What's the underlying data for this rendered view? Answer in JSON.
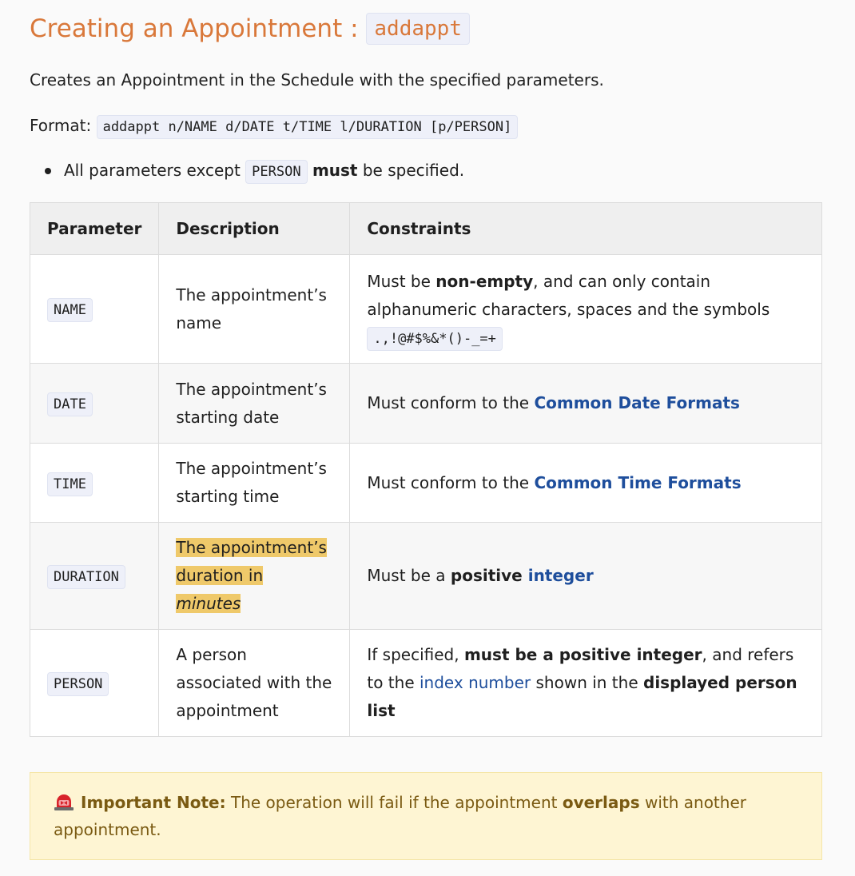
{
  "heading": {
    "title": "Creating an Appointment : ",
    "command": "addappt"
  },
  "description": "Creates an Appointment in the Schedule with the specified parameters.",
  "format": {
    "label": "Format: ",
    "command": "addappt n/NAME d/DATE t/TIME l/DURATION [p/PERSON]"
  },
  "bullet": {
    "pre": "All parameters except ",
    "code": "PERSON",
    "bold": "must",
    "post": " be specified."
  },
  "table": {
    "headers": [
      "Parameter",
      "Description",
      "Constraints"
    ],
    "rows": [
      {
        "param": "NAME",
        "desc": "The appointment’s name",
        "c_pre": "Must be ",
        "c_bold": "non-empty",
        "c_mid": ", and can only contain alphanumeric characters, spaces and the symbols ",
        "c_code": ".,!@#$%&*()-_=+"
      },
      {
        "param": "DATE",
        "desc": "The appointment’s starting date",
        "c_pre": "Must conform to the ",
        "c_link": "Common Date Formats"
      },
      {
        "param": "TIME",
        "desc": "The appointment’s starting time",
        "c_pre": "Must conform to the ",
        "c_link": "Common Time Formats"
      },
      {
        "param": "DURATION",
        "desc_pre": "The appointment’s duration in ",
        "desc_em": "minutes",
        "c_pre": "Must be a ",
        "c_bold": "positive",
        "c_link": " integer"
      },
      {
        "param": "PERSON",
        "desc": "A person associated with the appointment",
        "c_pre": "If specified, ",
        "c_bold": "must be a positive integer",
        "c_mid": ", and refers to the ",
        "c_link": "index number",
        "c_mid2": " shown in the ",
        "c_bold2": "displayed person list"
      }
    ]
  },
  "note": {
    "icon": "siren-icon",
    "label": "Important Note:",
    "pre": " The operation will fail if the appointment ",
    "bold": "overlaps",
    "post": " with another appointment."
  },
  "colors": {
    "heading": "#d9783a",
    "link": "#1e4e9c",
    "highlight": "#efc96a",
    "note_bg": "#fef5d3",
    "note_text": "#7a5a12"
  }
}
